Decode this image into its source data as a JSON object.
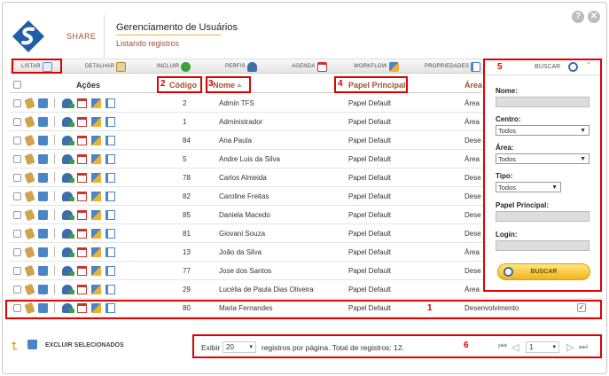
{
  "app": {
    "brand": "SHARE",
    "title": "Gerenciamento de Usuários",
    "subtitle": "Listando registros",
    "help_label": "?",
    "close_label": "✕"
  },
  "toolbar": {
    "tabs": [
      {
        "label": "LISTAR",
        "icon": "list-icon"
      },
      {
        "label": "DETALHAR",
        "icon": "detail-icon"
      },
      {
        "label": "INCLUIR",
        "icon": "add-icon"
      },
      {
        "label": "PERFIS",
        "icon": "profiles-icon"
      },
      {
        "label": "AGENDA",
        "icon": "calendar-icon"
      },
      {
        "label": "WORKFLOW",
        "icon": "workflow-icon"
      },
      {
        "label": "PROPRIEDADES",
        "icon": "properties-icon"
      }
    ],
    "search_label": "BUSCAR"
  },
  "table": {
    "headers": {
      "acoes": "Ações",
      "codigo": "Código",
      "nome": "Nome",
      "papel": "Papel Principal",
      "area": "Área"
    },
    "rows": [
      {
        "codigo": "2",
        "nome": "Admin TFS",
        "papel": "Papel Default",
        "area": "Área"
      },
      {
        "codigo": "1",
        "nome": "Administrador",
        "papel": "Papel Default",
        "area": "Área"
      },
      {
        "codigo": "84",
        "nome": "Ana Paula",
        "papel": "Papel Default",
        "area": "Dese"
      },
      {
        "codigo": "5",
        "nome": "Andre Luis da Silva",
        "papel": "Papel Default",
        "area": "Área"
      },
      {
        "codigo": "78",
        "nome": "Carlos Almeida",
        "papel": "Papel Default",
        "area": "Dese"
      },
      {
        "codigo": "82",
        "nome": "Caroline Freitas",
        "papel": "Papel Default",
        "area": "Dese"
      },
      {
        "codigo": "85",
        "nome": "Daniela Macedo",
        "papel": "Papel Default",
        "area": "Dese"
      },
      {
        "codigo": "81",
        "nome": "Giovani Souza",
        "papel": "Papel Default",
        "area": "Dese"
      },
      {
        "codigo": "13",
        "nome": "João da Silva",
        "papel": "Papel Default",
        "area": "Área"
      },
      {
        "codigo": "77",
        "nome": "Jose dos Santos",
        "papel": "Papel Default",
        "area": "Dese"
      },
      {
        "codigo": "29",
        "nome": "Lucélia de Paula Dias Oliveira",
        "papel": "Papel Default",
        "area": "Área"
      },
      {
        "codigo": "80",
        "nome": "Maria Fernandes",
        "papel": "Papel Default",
        "area": "Desenvolvimento"
      }
    ]
  },
  "search_panel": {
    "nome_label": "Nome:",
    "centro_label": "Centro:",
    "centro_value": "Todos",
    "area_label": "Área:",
    "area_value": "Todos",
    "tipo_label": "Tipo:",
    "tipo_value": "Todos",
    "papel_label": "Papel Principal:",
    "login_label": "Login:",
    "button_label": "BUSCAR"
  },
  "footer": {
    "delete_label": "EXCLUIR SELECIONADOS",
    "exibir_label": "Exibir",
    "per_page": "20",
    "per_page_text": "registros por página. Total de registros: 12.",
    "page": "1"
  },
  "annotations": {
    "n1": "1",
    "n2": "2",
    "n3": "3",
    "n4": "4",
    "n5": "5",
    "n6": "6"
  },
  "colors": {
    "highlight": "#e00000",
    "accent": "#a0522d",
    "button": "#f2b31a"
  }
}
